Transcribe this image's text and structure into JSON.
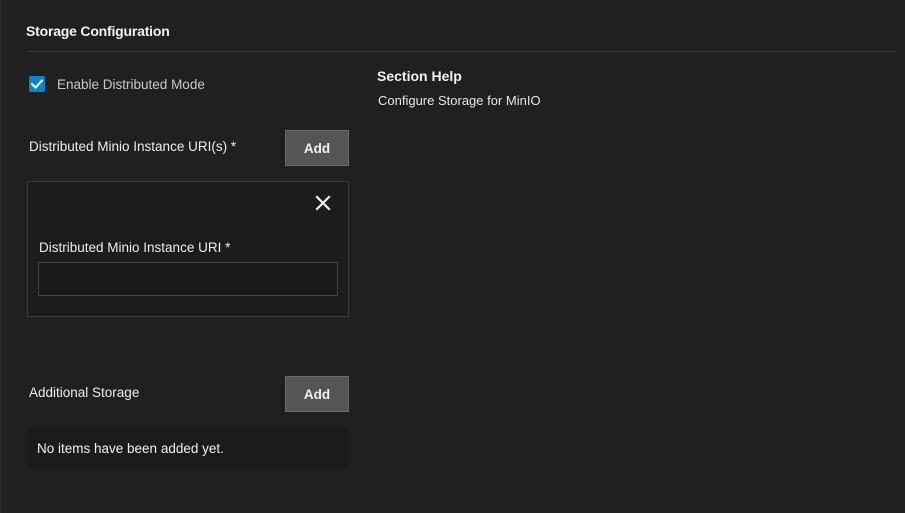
{
  "section": {
    "title": "Storage Configuration"
  },
  "distributed_mode": {
    "label": "Enable Distributed Mode",
    "checked": true,
    "color": "#0d84c9"
  },
  "distributed_uris": {
    "label": "Distributed Minio Instance URI(s) *",
    "add_label": "Add",
    "items": [
      {
        "field_label": "Distributed Minio Instance URI *",
        "value": "",
        "close_icon": "close-icon"
      }
    ]
  },
  "additional_storage": {
    "label": "Additional Storage",
    "add_label": "Add",
    "empty_message": "No items have been added yet."
  },
  "help": {
    "title": "Section Help",
    "text": "Configure Storage for MinIO"
  }
}
